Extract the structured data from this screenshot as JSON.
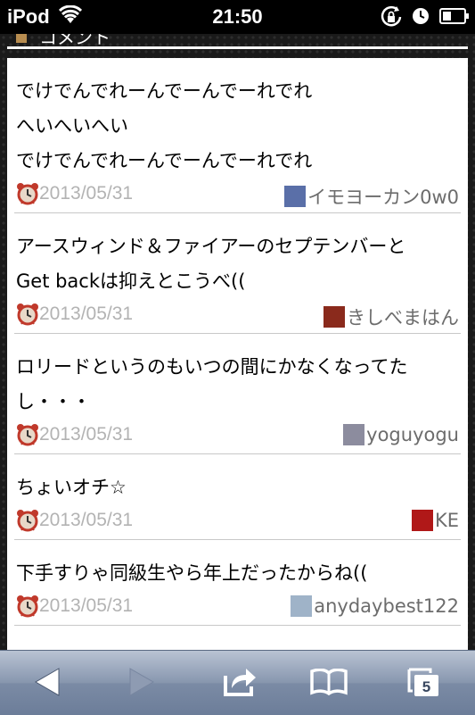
{
  "status": {
    "carrier": "iPod",
    "time": "21:50"
  },
  "section": {
    "title": "コメント"
  },
  "comments": [
    {
      "text": "でけでんでれーんでーんでーれでれ\nへいへいへい\nでけでんでれーんでーんでーれでれ",
      "date": "2013/05/31",
      "author": "イモヨーカン0w0",
      "avatar_color": "#5a6fa8"
    },
    {
      "text": "アースウィンド＆ファイアーのセプテンバーと\nGet backは抑えとこうべ((",
      "date": "2013/05/31",
      "author": "きしべまはん",
      "avatar_color": "#8a2a1c"
    },
    {
      "text": "ロリードというのもいつの間にかなくなってた\nし・・・",
      "date": "2013/05/31",
      "author": "yoguyogu",
      "avatar_color": "#8c8c9e"
    },
    {
      "text": "ちょいオチ☆",
      "date": "2013/05/31",
      "author": "KE",
      "avatar_color": "#b01818"
    },
    {
      "text": "下手すりゃ同級生やら年上だったからね((",
      "date": "2013/05/31",
      "author": "anydaybest122",
      "avatar_color": "#9fb3c8"
    }
  ],
  "toolbar": {
    "back_icon": "back-arrow-icon",
    "forward_icon": "forward-arrow-icon",
    "share_icon": "share-icon",
    "bookmarks_icon": "bookmarks-icon",
    "tabs_icon": "tabs-icon",
    "tab_count": "5"
  }
}
